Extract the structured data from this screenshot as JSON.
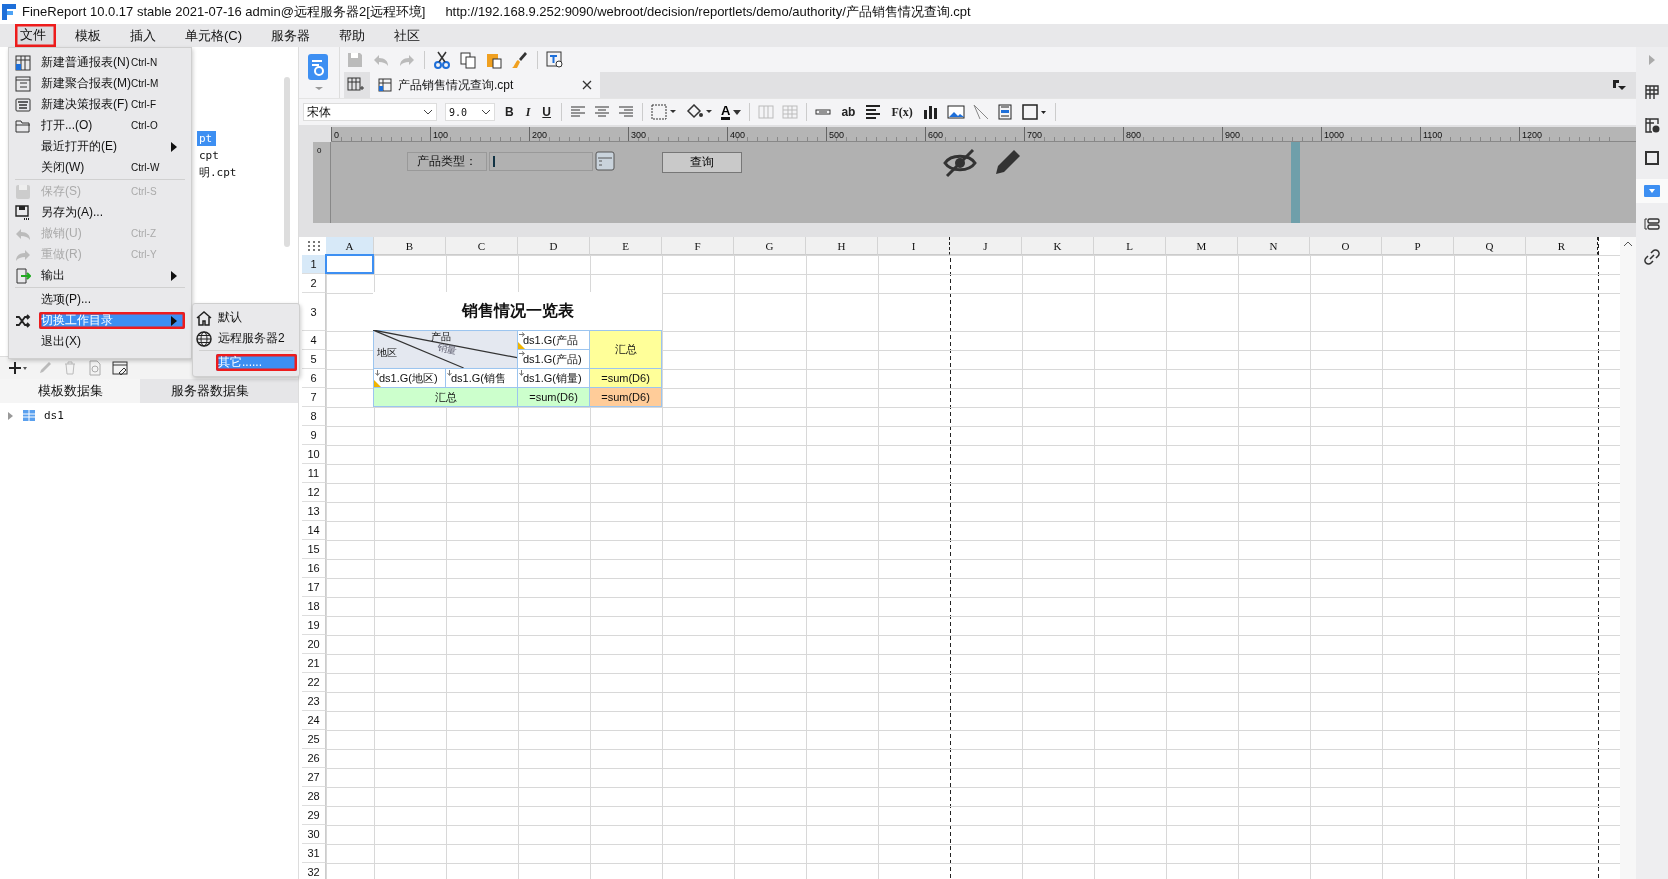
{
  "window": {
    "title": "FineReport 10.0.17 stable 2021-07-16 admin@远程服务器2[远程环境]",
    "url": "http://192.168.9.252:9090/webroot/decision/reportlets/demo/authority/产品销售情况查询.cpt"
  },
  "menubar": [
    {
      "label": "文件",
      "selected": true,
      "annotated": true
    },
    {
      "label": "模板",
      "selected": false,
      "annotated": false
    },
    {
      "label": "插入",
      "selected": false,
      "annotated": false
    },
    {
      "label": "单元格(C)",
      "selected": false,
      "annotated": false
    },
    {
      "label": "服务器",
      "selected": false,
      "annotated": false
    },
    {
      "label": "帮助",
      "selected": false,
      "annotated": false
    },
    {
      "label": "社区",
      "selected": false,
      "annotated": false
    }
  ],
  "file_menu": {
    "groups": [
      [
        {
          "label": "新建普通报表(N)",
          "shortcut": "Ctrl-N",
          "disabled": false,
          "submenu": false,
          "selected": false,
          "annotated": false
        },
        {
          "label": "新建聚合报表(M)",
          "shortcut": "Ctrl-M",
          "disabled": false,
          "submenu": false,
          "selected": false,
          "annotated": false
        },
        {
          "label": "新建决策报表(F)",
          "shortcut": "Ctrl-F",
          "disabled": false,
          "submenu": false,
          "selected": false,
          "annotated": false
        },
        {
          "label": "打开...(O)",
          "shortcut": "Ctrl-O",
          "disabled": false,
          "submenu": false,
          "selected": false,
          "annotated": false
        },
        {
          "label": "最近打开的(E)",
          "disabled": false,
          "submenu": true,
          "selected": false,
          "annotated": false
        },
        {
          "label": "关闭(W)",
          "shortcut": "Ctrl-W",
          "disabled": false,
          "submenu": false,
          "selected": false,
          "annotated": false
        }
      ],
      [
        {
          "label": "保存(S)",
          "shortcut": "Ctrl-S",
          "disabled": true,
          "submenu": false,
          "selected": false,
          "annotated": false
        },
        {
          "label": "另存为(A)...",
          "disabled": false,
          "submenu": false,
          "selected": false,
          "annotated": false
        },
        {
          "label": "撤销(U)",
          "shortcut": "Ctrl-Z",
          "disabled": true,
          "submenu": false,
          "selected": false,
          "annotated": false
        },
        {
          "label": "重做(R)",
          "shortcut": "Ctrl-Y",
          "disabled": true,
          "submenu": false,
          "selected": false,
          "annotated": false
        },
        {
          "label": "输出",
          "disabled": false,
          "submenu": true,
          "selected": false,
          "annotated": false
        }
      ],
      [
        {
          "label": "选项(P)...",
          "disabled": false,
          "submenu": false,
          "selected": false,
          "annotated": false
        },
        {
          "label": "切换工作目录",
          "disabled": false,
          "submenu": true,
          "selected": true,
          "annotated": true
        },
        {
          "label": "退出(X)",
          "disabled": false,
          "submenu": false,
          "selected": false,
          "annotated": false
        }
      ]
    ]
  },
  "submenu": {
    "groups": [
      [
        {
          "label": "默认",
          "selected": false,
          "annotated": false
        },
        {
          "label": "远程服务器2",
          "selected": false,
          "annotated": false
        }
      ],
      [
        {
          "label": "其它......",
          "selected": true,
          "annotated": true
        }
      ]
    ]
  },
  "template_files": [
    {
      "text": "pt",
      "selected": true
    },
    {
      "text": "cpt",
      "selected": false
    },
    {
      "text": "明.cpt",
      "selected": false
    }
  ],
  "dataset_tabs": [
    {
      "label": "模板数据集",
      "selected": true
    },
    {
      "label": "服务器数据集",
      "selected": false
    }
  ],
  "datasets": [
    {
      "label": "ds1",
      "expanded": false
    }
  ],
  "tab": {
    "title": "产品销售情况查询.cpt"
  },
  "format_toolbar": {
    "font": "宋体",
    "size": "9.0",
    "bold": "B",
    "italic": "I",
    "underline": "U",
    "font_color": "A",
    "text_tool": "ab",
    "formula": "F(x)"
  },
  "ruler": [
    "0",
    "100",
    "200",
    "300",
    "400",
    "500",
    "600",
    "700",
    "800",
    "900",
    "1000",
    "1100",
    "1200"
  ],
  "vertical_ruler": "0",
  "parameter_pane": {
    "label": "产品类型：",
    "button": "查询"
  },
  "sheet": {
    "columns": [
      {
        "label": "A",
        "selected": true,
        "page_break": false
      },
      {
        "label": "B",
        "selected": false,
        "page_break": false
      },
      {
        "label": "C",
        "selected": false,
        "page_break": false
      },
      {
        "label": "D",
        "selected": false,
        "page_break": false
      },
      {
        "label": "E",
        "selected": false,
        "page_break": false
      },
      {
        "label": "F",
        "selected": false,
        "page_break": false
      },
      {
        "label": "G",
        "selected": false,
        "page_break": false
      },
      {
        "label": "H",
        "selected": false,
        "page_break": false
      },
      {
        "label": "I",
        "selected": false,
        "page_break": true
      },
      {
        "label": "J",
        "selected": false,
        "page_break": false
      },
      {
        "label": "K",
        "selected": false,
        "page_break": false
      },
      {
        "label": "L",
        "selected": false,
        "page_break": false
      },
      {
        "label": "M",
        "selected": false,
        "page_break": false
      },
      {
        "label": "N",
        "selected": false,
        "page_break": false
      },
      {
        "label": "O",
        "selected": false,
        "page_break": false
      },
      {
        "label": "P",
        "selected": false,
        "page_break": false
      },
      {
        "label": "Q",
        "selected": false,
        "page_break": false
      },
      {
        "label": "R",
        "selected": false,
        "page_break": true
      }
    ],
    "rows": [
      {
        "label": "1",
        "selected": true
      },
      {
        "label": "2",
        "selected": false
      },
      {
        "label": "3",
        "selected": false
      },
      {
        "label": "4",
        "selected": false
      },
      {
        "label": "5",
        "selected": false
      },
      {
        "label": "6",
        "selected": false
      },
      {
        "label": "7",
        "selected": false
      },
      {
        "label": "8",
        "selected": false
      },
      {
        "label": "9",
        "selected": false
      },
      {
        "label": "10",
        "selected": false
      },
      {
        "label": "11",
        "selected": false
      },
      {
        "label": "12",
        "selected": false
      },
      {
        "label": "13",
        "selected": false
      },
      {
        "label": "14",
        "selected": false
      },
      {
        "label": "15",
        "selected": false
      },
      {
        "label": "16",
        "selected": false
      },
      {
        "label": "17",
        "selected": false
      },
      {
        "label": "18",
        "selected": false
      },
      {
        "label": "19",
        "selected": false
      },
      {
        "label": "20",
        "selected": false
      },
      {
        "label": "21",
        "selected": false
      },
      {
        "label": "22",
        "selected": false
      },
      {
        "label": "23",
        "selected": false
      },
      {
        "label": "24",
        "selected": false
      },
      {
        "label": "25",
        "selected": false
      },
      {
        "label": "26",
        "selected": false
      },
      {
        "label": "27",
        "selected": false
      },
      {
        "label": "28",
        "selected": false
      },
      {
        "label": "29",
        "selected": false
      },
      {
        "label": "30",
        "selected": false
      },
      {
        "label": "31",
        "selected": false
      },
      {
        "label": "32",
        "selected": false
      }
    ],
    "cells": [
      {
        "kind": "title",
        "text": "销售情况一览表",
        "color": "#ffffff"
      },
      {
        "kind": "diagonal",
        "top": "产品",
        "middle": "销量",
        "left": "地区",
        "color": "#e4e8f0"
      },
      {
        "kind": "field",
        "text": "ds1.G(产品",
        "expand_down": false,
        "corner_mark": true,
        "color": "#ffffff"
      },
      {
        "kind": "field",
        "text": "ds1.G(产品)",
        "expand_down": false,
        "corner_mark": false,
        "color": "#ffffff"
      },
      {
        "kind": "plain",
        "text": "汇总",
        "color": "#ffff99"
      },
      {
        "kind": "field",
        "text": "ds1.G(地区)",
        "expand_down": true,
        "corner_mark": true,
        "color": "#ffffff"
      },
      {
        "kind": "field",
        "text": "ds1.G(销售",
        "expand_down": true,
        "corner_mark": false,
        "color": "#ffffff"
      },
      {
        "kind": "field",
        "text": "ds1.G(销量)",
        "expand_down": true,
        "corner_mark": false,
        "color": "#ffffff"
      },
      {
        "kind": "plain",
        "text": "=sum(D6)",
        "color": "#ffff99"
      },
      {
        "kind": "plain",
        "text": "汇总",
        "color": "#ccffcc"
      },
      {
        "kind": "plain",
        "text": "=sum(D6)",
        "color": "#ccffcc"
      },
      {
        "kind": "plain",
        "text": "=sum(D6)",
        "color": "#ffcc99"
      }
    ]
  },
  "right_panel_tabs": [
    {
      "selected": false
    },
    {
      "selected": false
    },
    {
      "selected": false
    },
    {
      "selected": true
    },
    {
      "selected": false
    },
    {
      "selected": false
    }
  ]
}
